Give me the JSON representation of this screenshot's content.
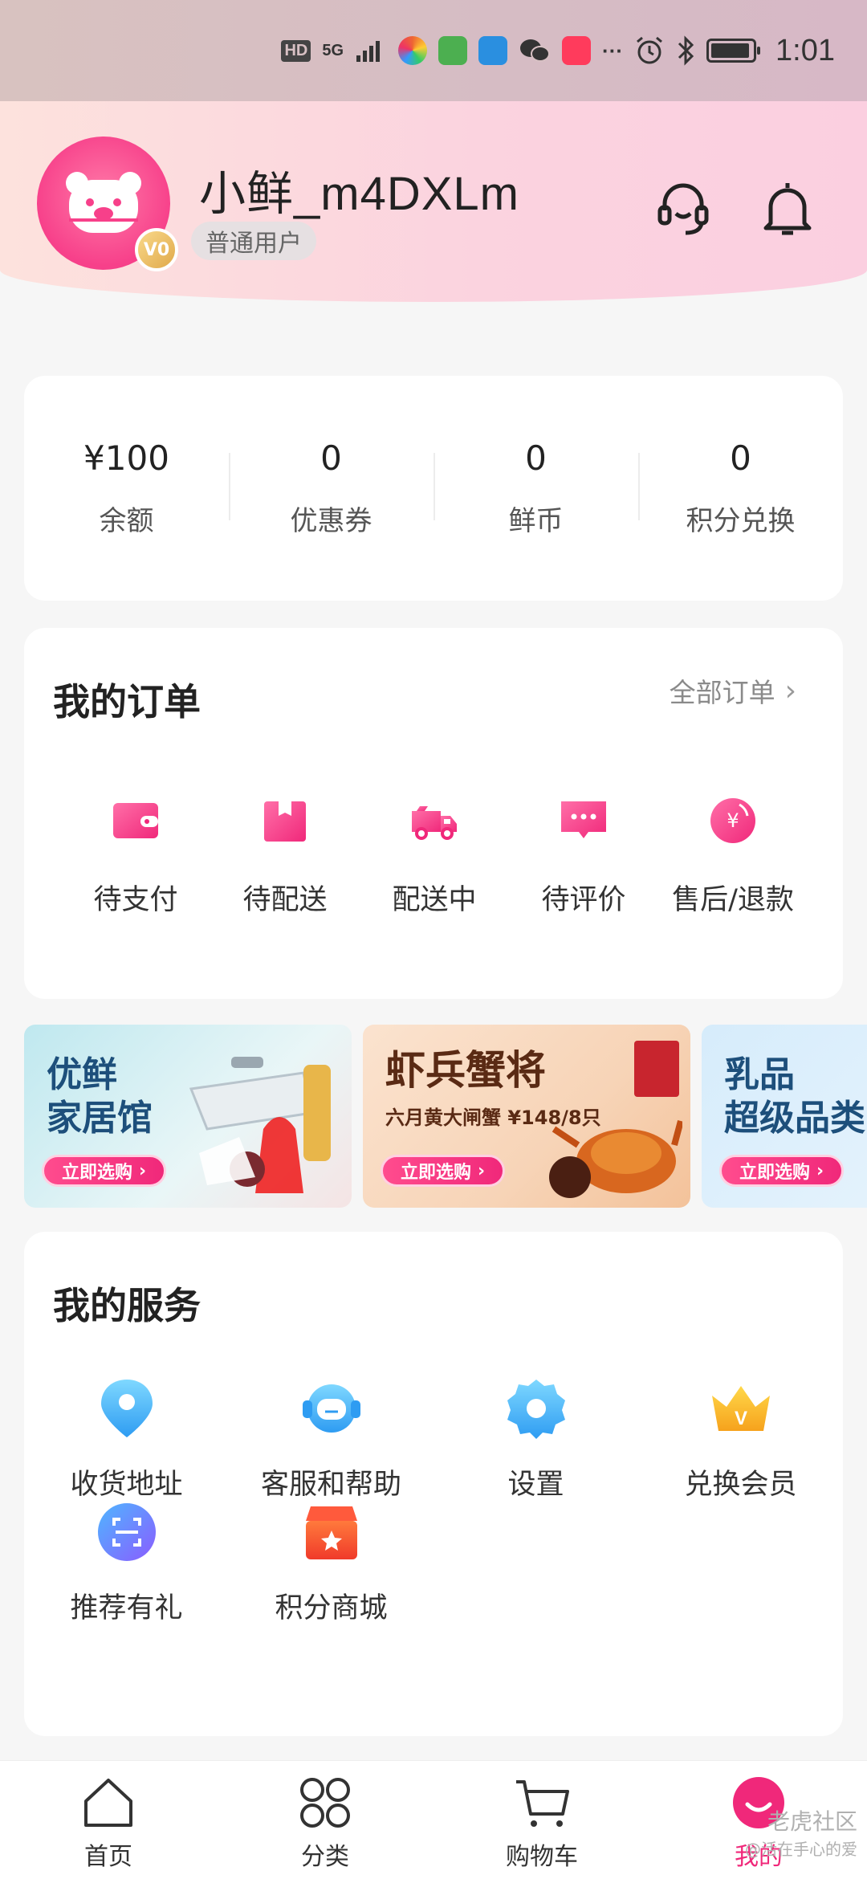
{
  "status_bar": {
    "hd": "HD",
    "network": "5G",
    "more": "···",
    "time": "1:01"
  },
  "header": {
    "username": "小鲜_m4DXLm",
    "level": "普通用户",
    "vip_badge": "V0"
  },
  "stats": [
    {
      "value": "¥100",
      "label": "余额"
    },
    {
      "value": "0",
      "label": "优惠券"
    },
    {
      "value": "0",
      "label": "鲜币"
    },
    {
      "value": "0",
      "label": "积分兑换"
    }
  ],
  "orders": {
    "title": "我的订单",
    "all_label": "全部订单",
    "items": [
      {
        "label": "待支付",
        "icon": "wallet-icon"
      },
      {
        "label": "待配送",
        "icon": "package-icon"
      },
      {
        "label": "配送中",
        "icon": "delivery-truck-icon"
      },
      {
        "label": "待评价",
        "icon": "comment-icon"
      },
      {
        "label": "售后/退款",
        "icon": "refund-icon"
      }
    ]
  },
  "banners": [
    {
      "title_line1": "优鲜",
      "title_line2": "家居馆",
      "button": "立即选购"
    },
    {
      "title": "虾兵蟹将",
      "subtitle": "六月黄大闸蟹 ¥148/8只",
      "button": "立即选购"
    },
    {
      "title_line1": "乳品",
      "title_line2": "超级品类",
      "button": "立即选购"
    }
  ],
  "services": {
    "title": "我的服务",
    "items": [
      {
        "label": "收货地址",
        "icon": "location-pin-icon"
      },
      {
        "label": "客服和帮助",
        "icon": "customer-service-icon"
      },
      {
        "label": "设置",
        "icon": "settings-gear-icon"
      },
      {
        "label": "兑换会员",
        "icon": "vip-crown-icon"
      },
      {
        "label": "推荐有礼",
        "icon": "scan-icon"
      },
      {
        "label": "积分商城",
        "icon": "points-store-icon"
      }
    ]
  },
  "bottom_nav": {
    "items": [
      {
        "label": "首页",
        "icon": "home-icon"
      },
      {
        "label": "分类",
        "icon": "category-grid-icon"
      },
      {
        "label": "购物车",
        "icon": "cart-icon"
      },
      {
        "label": "我的",
        "icon": "profile-icon",
        "active": true
      }
    ]
  },
  "watermark": {
    "line1": "老虎社区",
    "line2": "@活在手心的爱"
  },
  "colors": {
    "accent": "#f0287a",
    "header_gradient_start": "#fde2dd",
    "header_gradient_end": "#fbcfe0"
  }
}
